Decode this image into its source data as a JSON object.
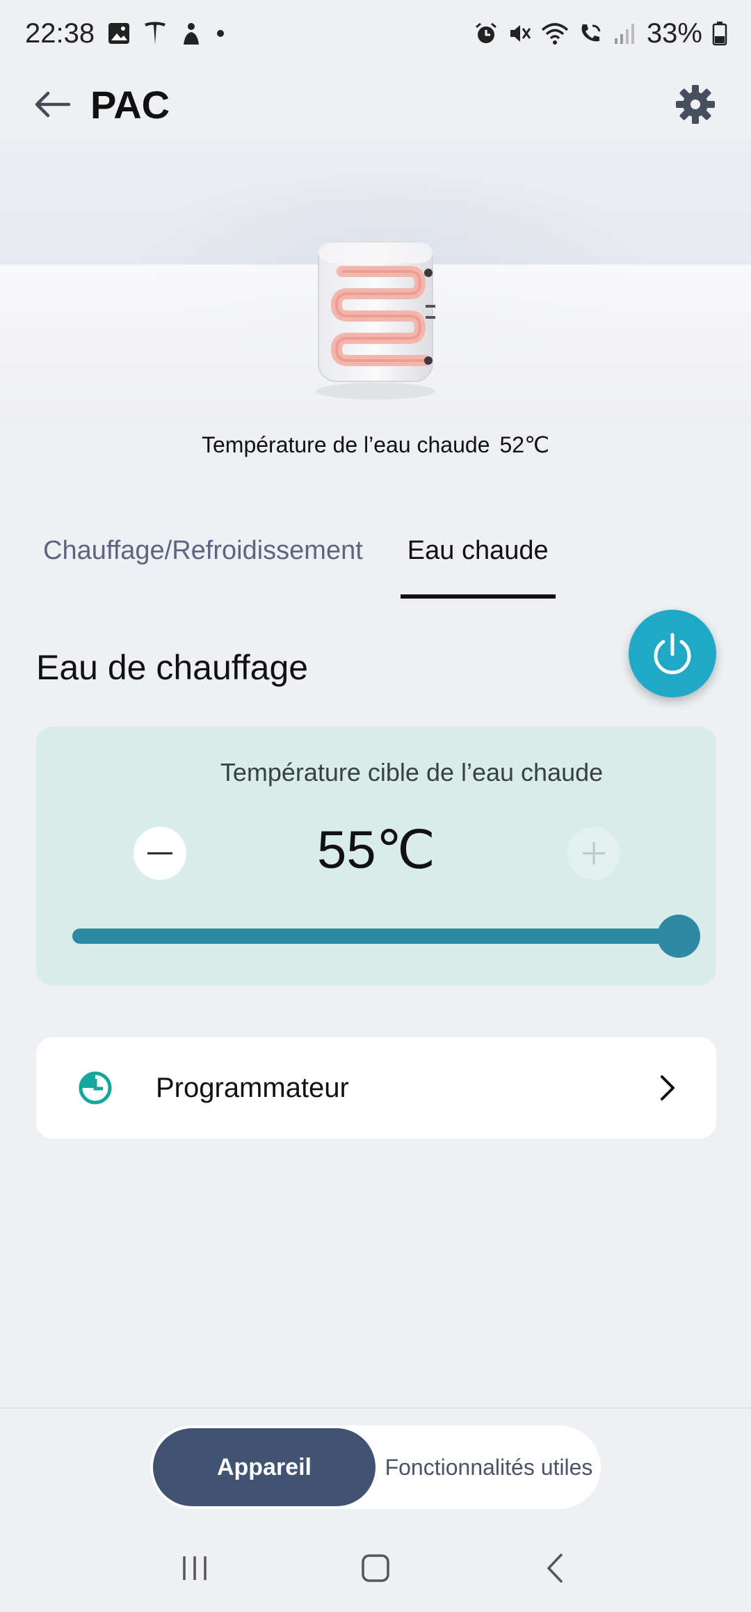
{
  "status_bar": {
    "time": "22:38",
    "battery": "33%",
    "left_icons": [
      "gallery-icon",
      "tesla-icon",
      "sleep-icon",
      "dot-icon"
    ],
    "right_icons": [
      "alarm-icon",
      "mute-icon",
      "wifi-icon",
      "wifi-call-icon",
      "signal-icon",
      "battery-icon"
    ]
  },
  "header": {
    "title": "PAC"
  },
  "hero": {
    "label": "Température de l’eau chaude",
    "value": "52℃"
  },
  "tabs": [
    {
      "label": "Chauffage/Refroidissement",
      "active": false
    },
    {
      "label": "Eau chaude",
      "active": true
    }
  ],
  "section": {
    "title": "Eau de chauffage"
  },
  "target": {
    "label": "Température cible de l’eau chaude",
    "value": "55℃",
    "slider_fraction": 1.0
  },
  "programmer": {
    "label": "Programmateur"
  },
  "bottom_nav": {
    "active": "Appareil",
    "inactive": "Fonctionnalités utiles"
  },
  "colors": {
    "accent": "#1eaac7",
    "slider": "#2e8aa3",
    "nav_active": "#415372",
    "card": "#d8edea",
    "clock_icon": "#13a89e"
  }
}
